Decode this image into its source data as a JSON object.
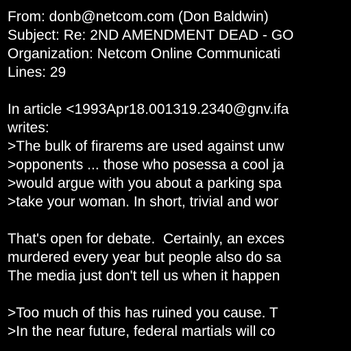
{
  "email": {
    "header": {
      "from": "From: donb@netcom.com (Don Baldwin)",
      "subject": "Subject: Re: 2ND AMENDMENT DEAD - GO",
      "organization": "Organization: Netcom Online Communicati",
      "lines": "Lines: 29"
    },
    "body": {
      "attribution_1": "In article <1993Apr18.001319.2340@gnv.ifa",
      "attribution_2": "writes:",
      "quote_1": ">The bulk of firarems are used against unw",
      "quote_2": ">opponents ... those who posessa a cool ja",
      "quote_3": ">would argue with you about a parking spa",
      "quote_4": ">take your woman. In short, trivial and wor",
      "reply_1": "That's open for debate.  Certainly, an exces",
      "reply_2": "murdered every year but people also do sa",
      "reply_3": "The media just don't tell us when it happen",
      "quote_5": ">Too much of this has ruined you cause. T",
      "quote_6": ">In the near future, federal martials will co"
    }
  },
  "colors": {
    "background": "#000000",
    "text": "#ffffff"
  }
}
